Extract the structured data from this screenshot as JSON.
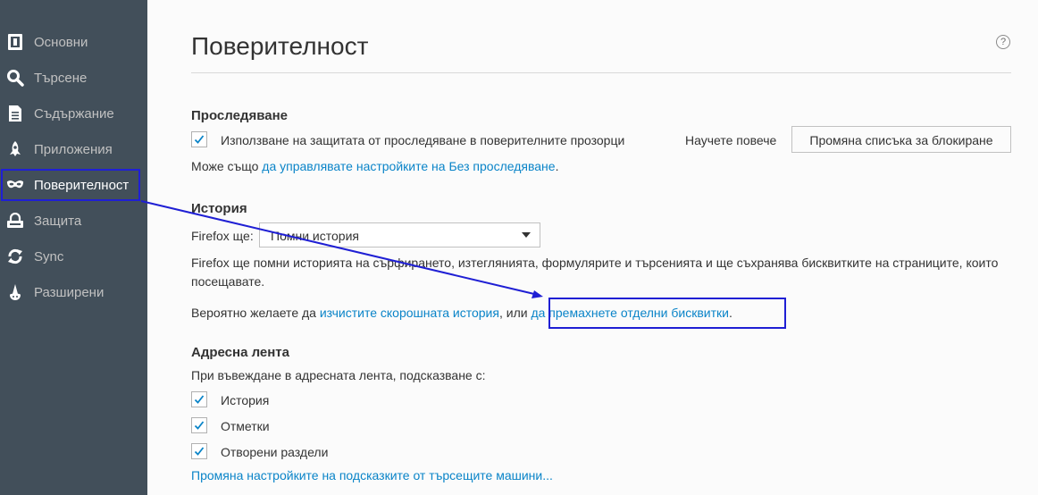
{
  "sidebar": {
    "items": [
      {
        "label": "Основни",
        "icon": "general-icon"
      },
      {
        "label": "Търсене",
        "icon": "search-icon"
      },
      {
        "label": "Съдържание",
        "icon": "content-icon"
      },
      {
        "label": "Приложения",
        "icon": "applications-icon"
      },
      {
        "label": "Поверителност",
        "icon": "privacy-mask-icon",
        "selected": true
      },
      {
        "label": "Защита",
        "icon": "security-lock-icon"
      },
      {
        "label": "Sync",
        "icon": "sync-icon"
      },
      {
        "label": "Разширени",
        "icon": "advanced-wizard-icon"
      }
    ]
  },
  "header": {
    "title": "Поверителност",
    "help": "?"
  },
  "tracking": {
    "heading": "Проследяване",
    "checkbox_label": "Използване на защитата от проследяване в поверителните прозорци",
    "checked": true,
    "learn_more": "Научете повече",
    "change_blocklist": "Промяна списъка за блокиране",
    "also_prefix": "Може също ",
    "also_link": "да управлявате настройките на Без проследяване",
    "also_suffix": "."
  },
  "history": {
    "heading": "История",
    "firefox_will": "Firefox ще:",
    "select_value": "Помни история",
    "description": "Firefox ще помни историята на сърфирането, изтеглянията, формулярите и търсенията и ще съхранява бисквитките на страниците, които посещавате.",
    "clear_prefix": "Вероятно желаете да ",
    "clear_link": "изчистите скорошната история",
    "clear_middle": ", или ",
    "remove_link": "да премахнете отделни бисквитки",
    "clear_suffix": "."
  },
  "address_bar": {
    "heading": "Адресна лента",
    "intro": "При въвеждане в адресната лента, подсказване с:",
    "options": [
      {
        "label": "История",
        "checked": true
      },
      {
        "label": "Отметки",
        "checked": true
      },
      {
        "label": "Отворени раздели",
        "checked": true
      }
    ],
    "search_suggestions_link": "Промяна настройките на подсказките от търсещите машини..."
  },
  "colors": {
    "sidebar_bg": "#424f5a",
    "link": "#0a84c8",
    "annotation": "#1f1fd4",
    "check": "#0a84c8"
  }
}
